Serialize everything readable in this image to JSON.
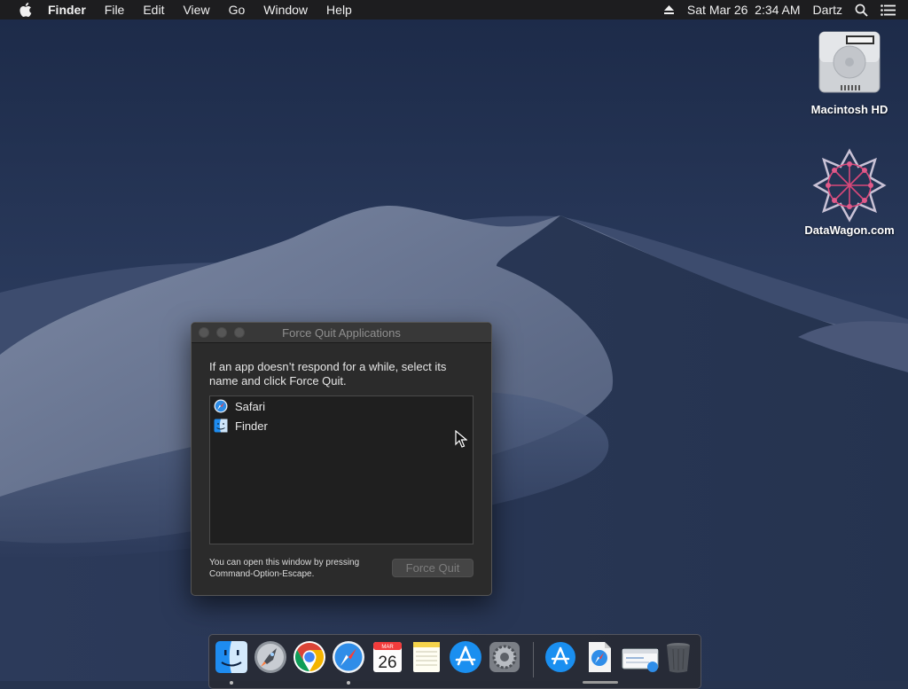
{
  "menubar": {
    "items": [
      "Finder",
      "File",
      "Edit",
      "View",
      "Go",
      "Window",
      "Help"
    ],
    "datetime": "Sat Mar 26  2:34 AM",
    "user": "Dartz"
  },
  "desktop": {
    "icons": [
      {
        "label": "Macintosh HD",
        "icon": "hard-drive-icon"
      },
      {
        "label": "DataWagon.com",
        "icon": "datawagon-logo-icon"
      }
    ]
  },
  "force_quit": {
    "title": "Force Quit Applications",
    "prompt": "If an app doesn’t respond for a while, select its name and click Force Quit.",
    "apps": [
      {
        "name": "Safari",
        "icon": "safari-icon"
      },
      {
        "name": "Finder",
        "icon": "finder-icon"
      }
    ],
    "hint": "You can open this window by pressing Command-Option-Escape.",
    "button_label": "Force Quit",
    "button_enabled": false
  },
  "dock": {
    "items": [
      {
        "name": "Finder",
        "icon": "finder-icon",
        "running": true
      },
      {
        "name": "Launchpad",
        "icon": "launchpad-icon",
        "running": false
      },
      {
        "name": "Google Chrome",
        "icon": "chrome-icon",
        "running": false
      },
      {
        "name": "Safari",
        "icon": "safari-icon",
        "running": true
      },
      {
        "name": "Calendar",
        "icon": "calendar-icon",
        "running": false,
        "month": "MAR",
        "day": "26"
      },
      {
        "name": "Notes",
        "icon": "notes-icon",
        "running": false
      },
      {
        "name": "App Store",
        "icon": "app-store-icon",
        "running": false
      },
      {
        "name": "System Preferences",
        "icon": "system-preferences-icon",
        "running": false
      },
      {
        "name": "Applications",
        "icon": "applications-folder-icon",
        "running": false
      },
      {
        "name": "Downloads",
        "icon": "downloads-stack-icon",
        "running": false
      },
      {
        "name": "Safari window",
        "icon": "minimized-window-icon",
        "running": false
      },
      {
        "name": "Trash",
        "icon": "trash-icon",
        "running": false
      }
    ]
  },
  "colors": {
    "menubar_bg": "#1d1d1f",
    "window_bg": "#2b2b2b",
    "list_bg": "#1f1f1f",
    "sky_top": "#1c2a48",
    "dune": "#6b7894"
  }
}
